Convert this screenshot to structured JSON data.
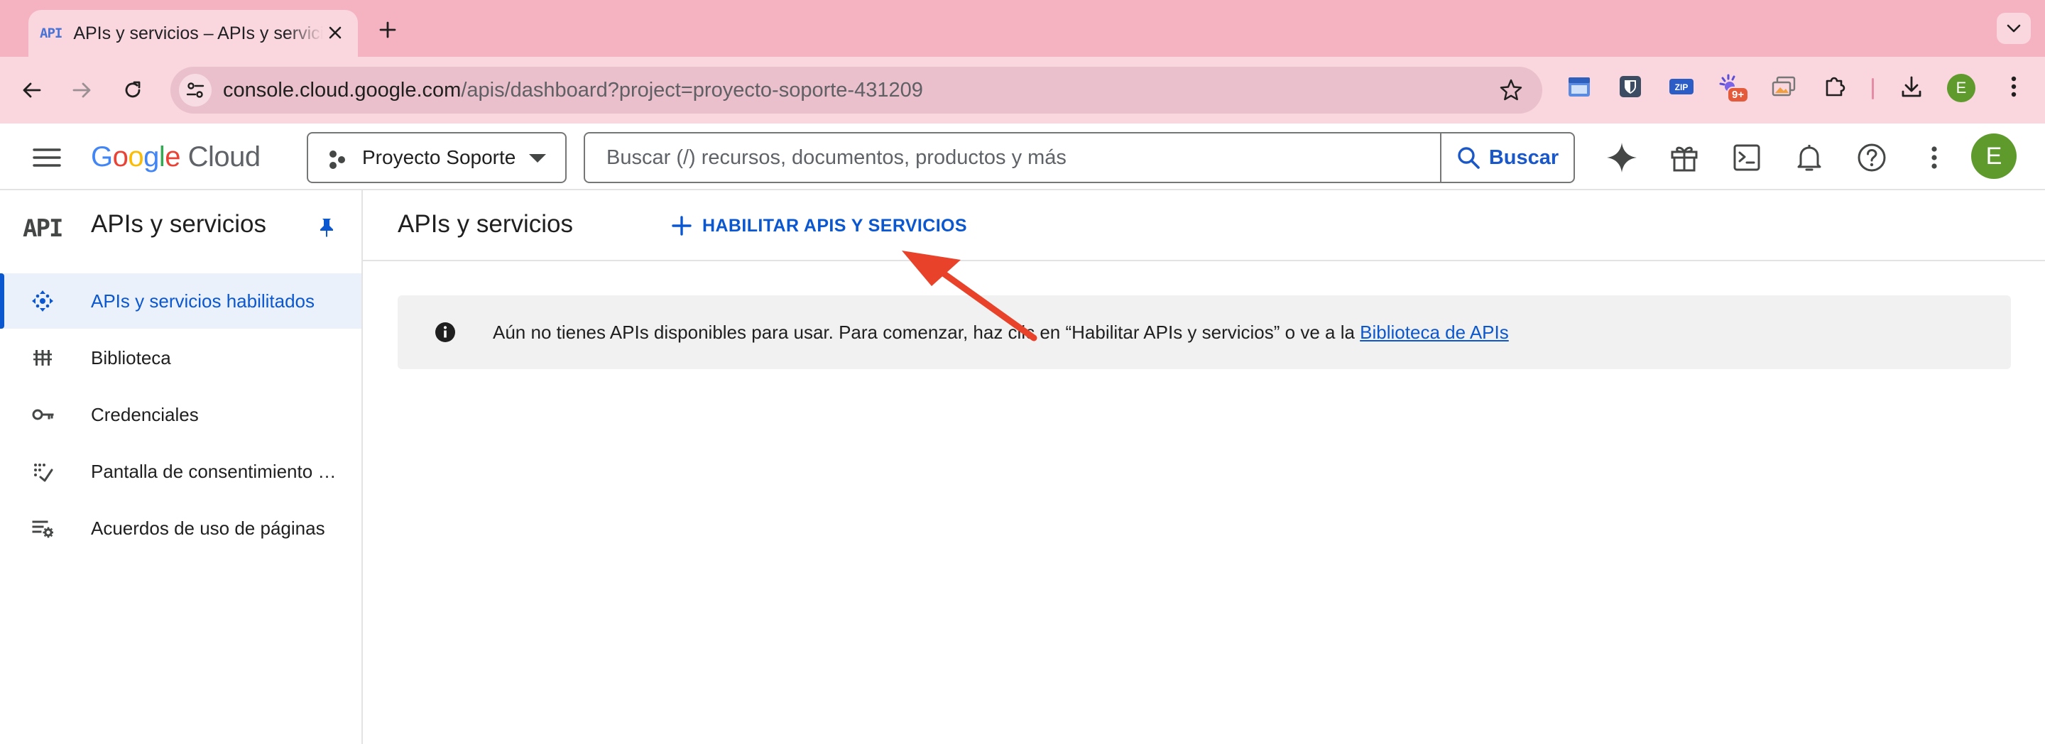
{
  "browser": {
    "tab_favicon": "API",
    "tab_title": "APIs y servicios – APIs y servicios",
    "url_host": "console.cloud.google.com",
    "url_path": "/apis/dashboard?project=proyecto-soporte-431209",
    "extensions": [
      "calendar-ext-icon",
      "bitwarden-shield-icon",
      "zip-ext-icon",
      "notification-ext-icon",
      "screenshot-ext-icon",
      "puzzle-icon"
    ],
    "extension_badge": "9+",
    "profile_initial": "E"
  },
  "header": {
    "logo_google": "Google",
    "logo_cloud": "Cloud",
    "project_name": "Proyecto Soporte",
    "search_placeholder": "Buscar (/) recursos, documentos, productos y más",
    "search_button": "Buscar",
    "avatar_initial": "E"
  },
  "sidebar": {
    "logo": "API",
    "title": "APIs y servicios",
    "items": [
      {
        "label": "APIs y servicios habilitados",
        "icon": "apis-services-icon",
        "active": true
      },
      {
        "label": "Biblioteca",
        "icon": "library-icon",
        "active": false
      },
      {
        "label": "Credenciales",
        "icon": "key-icon",
        "active": false
      },
      {
        "label": "Pantalla de consentimiento de OAuth",
        "icon": "consent-screen-icon",
        "active": false
      },
      {
        "label": "Acuerdos de uso de páginas",
        "icon": "page-usage-agreements-icon",
        "active": false
      }
    ]
  },
  "main": {
    "title": "APIs y servicios",
    "enable_button": "HABILITAR APIS Y SERVICIOS",
    "banner_text": "Aún no tienes APIs disponibles para usar. Para comenzar, haz clic en “Habilitar APIs y servicios” o ve a la ",
    "banner_link": "Biblioteca de APIs"
  },
  "colors": {
    "accent": "#0b57d0",
    "arrow": "#e8432a",
    "chrome_tabstrip": "#f5b3c2",
    "chrome_toolbar": "#fad6de"
  }
}
